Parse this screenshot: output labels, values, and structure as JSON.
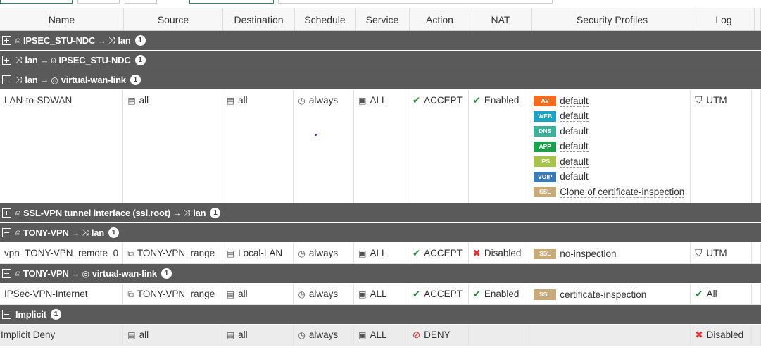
{
  "columns": [
    "Name",
    "Source",
    "Destination",
    "Schedule",
    "Service",
    "Action",
    "NAT",
    "Security Profiles",
    "Log"
  ],
  "groups": [
    {
      "from": "IPSEC_STU-NDC",
      "arrow": "→",
      "to": "lan",
      "count": "1"
    },
    {
      "from": "lan",
      "arrow": "→",
      "to": "IPSEC_STU-NDC",
      "count": "1"
    },
    {
      "from": "lan",
      "arrow": "→",
      "to": "virtual-wan-link",
      "count": "1"
    },
    {
      "from": "SSL-VPN tunnel interface (ssl.root)",
      "arrow": "→",
      "to": "lan",
      "count": "1"
    },
    {
      "from": "TONY-VPN",
      "arrow": "→",
      "to": "lan",
      "count": "1"
    },
    {
      "from": "TONY-VPN",
      "arrow": "→",
      "to": "virtual-wan-link",
      "count": "1"
    },
    {
      "from": "Implicit",
      "count": "1"
    }
  ],
  "policies": [
    {
      "name": "LAN-to-SDWAN",
      "source": "all",
      "destination": "all",
      "schedule": "always",
      "service": "ALL",
      "action": "ACCEPT",
      "nat": "Enabled",
      "log": "UTM",
      "profiles": [
        {
          "tag": "AV",
          "color": "#f26c22",
          "name": "default"
        },
        {
          "tag": "WEB",
          "color": "#1ca3c4",
          "name": "default"
        },
        {
          "tag": "DNS",
          "color": "#3fb19a",
          "name": "default"
        },
        {
          "tag": "APP",
          "color": "#1e9e4a",
          "name": "default"
        },
        {
          "tag": "IPS",
          "color": "#a8c34a",
          "name": "default"
        },
        {
          "tag": "VOIP",
          "color": "#3c7ab8",
          "name": "default"
        },
        {
          "tag": "SSL",
          "color": "#c8a97a",
          "name": "Clone of certificate-inspection"
        }
      ]
    },
    {
      "name": "vpn_TONY-VPN_remote_0",
      "source": "TONY-VPN_range",
      "destination": "Local-LAN",
      "schedule": "always",
      "service": "ALL",
      "action": "ACCEPT",
      "nat": "Disabled",
      "log": "UTM",
      "profiles": [
        {
          "tag": "SSL",
          "color": "#c8a97a",
          "name": "no-inspection"
        }
      ]
    },
    {
      "name": "IPSec-VPN-Internet",
      "source": "TONY-VPN_range",
      "destination": "all",
      "schedule": "always",
      "service": "ALL",
      "action": "ACCEPT",
      "nat": "Enabled",
      "log": "All",
      "profiles": [
        {
          "tag": "SSL",
          "color": "#c8a97a",
          "name": "certificate-inspection"
        }
      ]
    },
    {
      "name": "Implicit Deny",
      "source": "all",
      "destination": "all",
      "schedule": "always",
      "service": "ALL",
      "action": "DENY",
      "log": "Disabled"
    }
  ]
}
